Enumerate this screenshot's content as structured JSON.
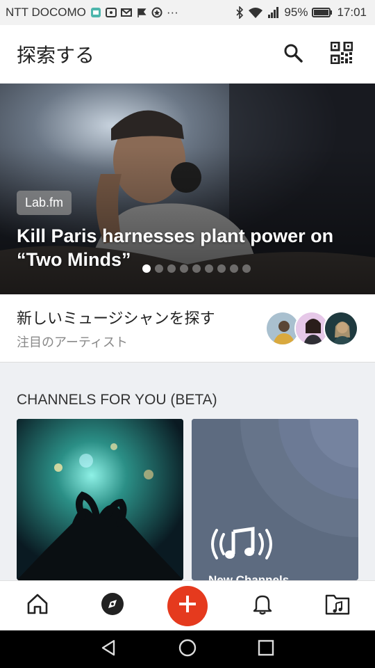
{
  "status_bar": {
    "carrier": "NTT DOCOMO",
    "more": "···",
    "battery": "95%",
    "time": "17:01"
  },
  "header": {
    "title": "探索する",
    "search_icon": "search-icon",
    "qr_icon": "qr-code-icon"
  },
  "hero": {
    "tag": "Lab.fm",
    "title": "Kill Paris harnesses plant power on “Two Minds”",
    "dots_total": 9,
    "dots_active": 1
  },
  "musicians": {
    "title": "新しいミュージシャンを探す",
    "subtitle": "注目のアーティスト"
  },
  "channels": {
    "section_title": "CHANNELS FOR YOU (BETA)",
    "card2_label": "New Channels"
  },
  "bottom_nav": {
    "items": [
      "home-icon",
      "explore-compass-icon",
      "add-icon",
      "notification-bell-icon",
      "music-folder-icon"
    ]
  },
  "colors": {
    "accent": "#e53a1e",
    "header_bg": "#ffffff",
    "page_bg": "#eef0f3"
  }
}
